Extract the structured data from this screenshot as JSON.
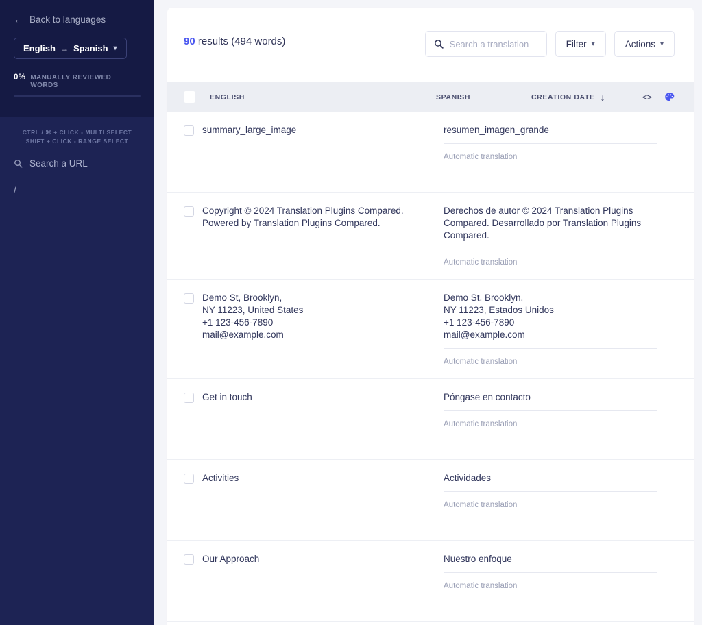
{
  "sidebar": {
    "back_link": "Back to languages",
    "back_icon": "arrow-left-icon",
    "language_pair": {
      "source": "English",
      "arrow": "→",
      "target": "Spanish",
      "chevron": "⌄"
    },
    "progress": {
      "percent_label": "0%",
      "caption": "MANUALLY REVIEWED WORDS",
      "value": 0
    },
    "hints": [
      "CTRL / ⌘ + CLICK - MULTI SELECT",
      "SHIFT + CLICK - RANGE SELECT"
    ],
    "url_search": {
      "icon": "search-icon",
      "placeholder": "Search a URL",
      "value": ""
    },
    "urls": [
      {
        "label": "/"
      }
    ]
  },
  "toolbar": {
    "results_count": "90",
    "results_rest": " results (494 words)",
    "search": {
      "icon": "search-icon",
      "placeholder": "Search a translation",
      "value": ""
    },
    "filter_label": "Filter",
    "actions_label": "Actions",
    "chevron": "⌄"
  },
  "table": {
    "columns": {
      "english": "ENGLISH",
      "spanish": "SPANISH",
      "creation_date": "CREATION DATE",
      "sort_arrow": "↓",
      "code_icon": "<>",
      "palette_icon": "palette-icon"
    },
    "meta_label": "Automatic translation",
    "rows": [
      {
        "source": "summary_large_image",
        "target": "resumen_imagen_grande",
        "meta": "Automatic translation"
      },
      {
        "source": "Copyright © 2024 Translation Plugins Compared. Powered by Translation Plugins Compared.",
        "target": "Derechos de autor © 2024 Translation Plugins Compared. Desarrollado por Translation Plugins Compared.",
        "meta": "Automatic translation"
      },
      {
        "source": "Demo St, Brooklyn,\nNY 11223, United States\n+1 123-456-7890\nmail@example.com",
        "target": "Demo St, Brooklyn,\nNY 11223, Estados Unidos\n+1 123-456-7890\nmail@example.com",
        "meta": "Automatic translation"
      },
      {
        "source": "Get in touch",
        "target": "Póngase en contacto",
        "meta": "Automatic translation"
      },
      {
        "source": "Activities",
        "target": "Actividades",
        "meta": "Automatic translation"
      },
      {
        "source": "Our Approach",
        "target": "Nuestro enfoque",
        "meta": "Automatic translation"
      }
    ]
  },
  "colors": {
    "sidebar_top": "#151a44",
    "sidebar_bottom": "#1d2354",
    "accent": "#4a57f0",
    "page_bg": "#f4f5f9",
    "table_header_bg": "#eceef3",
    "text_primary": "#32375c",
    "text_muted": "#9ba0b6"
  }
}
